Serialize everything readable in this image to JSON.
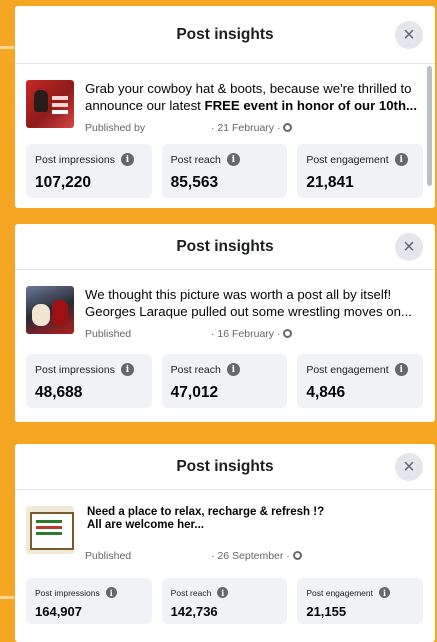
{
  "background_color": "#f5a623",
  "panels": [
    {
      "header_title": "Post insights",
      "close_icon": "close-icon",
      "post_text_line1": "Grab your cowboy hat & boots, because we're thrilled to",
      "post_text_line2_prefix": "announce our latest ",
      "post_text_line2_bold": "FREE event in honor of our 10th...",
      "published_label": "Published by",
      "date_text": "· 21 February ·",
      "metrics": [
        {
          "label": "Post impressions",
          "value": "107,220"
        },
        {
          "label": "Post reach",
          "value": "85,563"
        },
        {
          "label": "Post engagement",
          "value": "21,841"
        }
      ]
    },
    {
      "header_title": "Post insights",
      "close_icon": "close-icon",
      "post_text_line1": "We thought this picture was worth a post all by itself!",
      "post_text_line2": "Georges Laraque pulled out some wrestling moves on...",
      "published_label": "Published",
      "date_text": "· 16 February ·",
      "metrics": [
        {
          "label": "Post impressions",
          "value": "48,688"
        },
        {
          "label": "Post reach",
          "value": "47,012"
        },
        {
          "label": "Post engagement",
          "value": "4,846"
        }
      ]
    },
    {
      "header_title": "Post insights",
      "close_icon": "close-icon",
      "post_text_line1": "Need a place to relax, recharge & refresh !?",
      "post_text_line2": "All are welcome her...",
      "published_label": "Published",
      "date_text": "· 26 September ·",
      "metrics": [
        {
          "label": "Post impressions",
          "value": "164,907"
        },
        {
          "label": "Post reach",
          "value": "142,736"
        },
        {
          "label": "Post engagement",
          "value": "21,155"
        }
      ]
    }
  ]
}
